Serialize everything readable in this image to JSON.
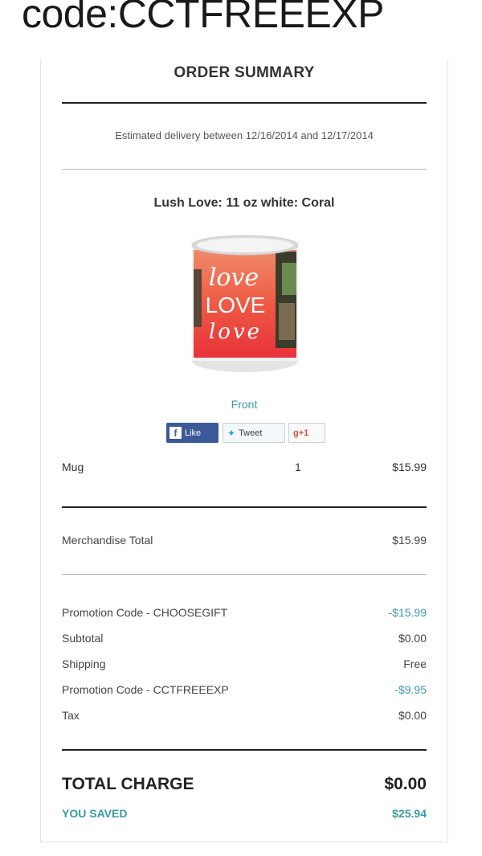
{
  "banner": {
    "text": "code:CCTFREEEXP"
  },
  "summary": {
    "title": "ORDER SUMMARY",
    "delivery": "Estimated delivery between 12/16/2014 and 12/17/2014"
  },
  "product": {
    "title": "Lush Love: 11 oz white: Coral",
    "image_text": [
      "love",
      "LOVE",
      "love"
    ],
    "view_label": "Front",
    "social": {
      "like": "Like",
      "tweet": "Tweet",
      "plus": "+1"
    }
  },
  "line_item": {
    "name": "Mug",
    "qty": "1",
    "price": "$15.99"
  },
  "merchandise": {
    "label": "Merchandise Total",
    "value": "$15.99"
  },
  "charges": [
    {
      "label": "Promotion Code - CHOOSEGIFT",
      "value": "-$15.99"
    },
    {
      "label": "Subtotal",
      "value": "$0.00"
    },
    {
      "label": "Shipping",
      "value": "Free"
    },
    {
      "label": "Promotion Code - CCTFREEEXP",
      "value": "-$9.95"
    },
    {
      "label": "Tax",
      "value": "$0.00"
    }
  ],
  "total": {
    "label": "TOTAL CHARGE",
    "value": "$0.00"
  },
  "saved": {
    "label": "YOU SAVED",
    "value": "$25.94"
  },
  "colors": {
    "accent": "#3a9aa6",
    "facebook": "#3b5998",
    "mug_coral": "#ef4a3c"
  }
}
